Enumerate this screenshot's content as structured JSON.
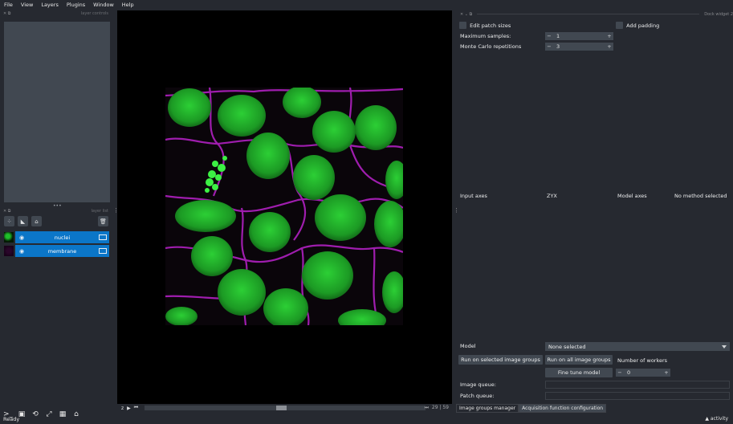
{
  "menu": [
    "File",
    "View",
    "Layers",
    "Plugins",
    "Window",
    "Help"
  ],
  "layer_controls": {
    "title": "layer controls"
  },
  "layer_list": {
    "title": "layer list",
    "layers": [
      {
        "name": "nuclei",
        "visible": true,
        "thumb_color": "#22aa22"
      },
      {
        "name": "membrane",
        "visible": true,
        "thumb_color": "#aa22aa"
      }
    ]
  },
  "dock": {
    "title": "Dock widget 2",
    "edit_patch_sizes": "Edit patch sizes",
    "add_padding": "Add padding",
    "max_samples_label": "Maximum samples:",
    "max_samples_value": "1",
    "mc_label": "Monte Carlo repetitions",
    "mc_value": "3",
    "input_axes_label": "Input axes",
    "input_axes_value": "ZYX",
    "model_axes_label": "Model axes",
    "model_axes_value": "No method selected",
    "model_label": "Model",
    "model_value": "None selected",
    "run_selected": "Run on selected image groups",
    "run_all": "Run on all image groups",
    "num_workers_label": "Number of workers",
    "fine_tune": "Fine tune model",
    "workers_value": "0",
    "image_queue": "Image queue:",
    "patch_queue": "Patch queue:"
  },
  "tabs": [
    "Image groups manager",
    "Acquisition function configuration"
  ],
  "slider": {
    "axis": "z",
    "current": "29",
    "total": "59"
  },
  "status": {
    "ready": "Ready",
    "activity": "activity"
  },
  "colors": {
    "nuclei": "#1fbf2a",
    "membrane": "#b020c0",
    "accent": "#0b76c8"
  }
}
